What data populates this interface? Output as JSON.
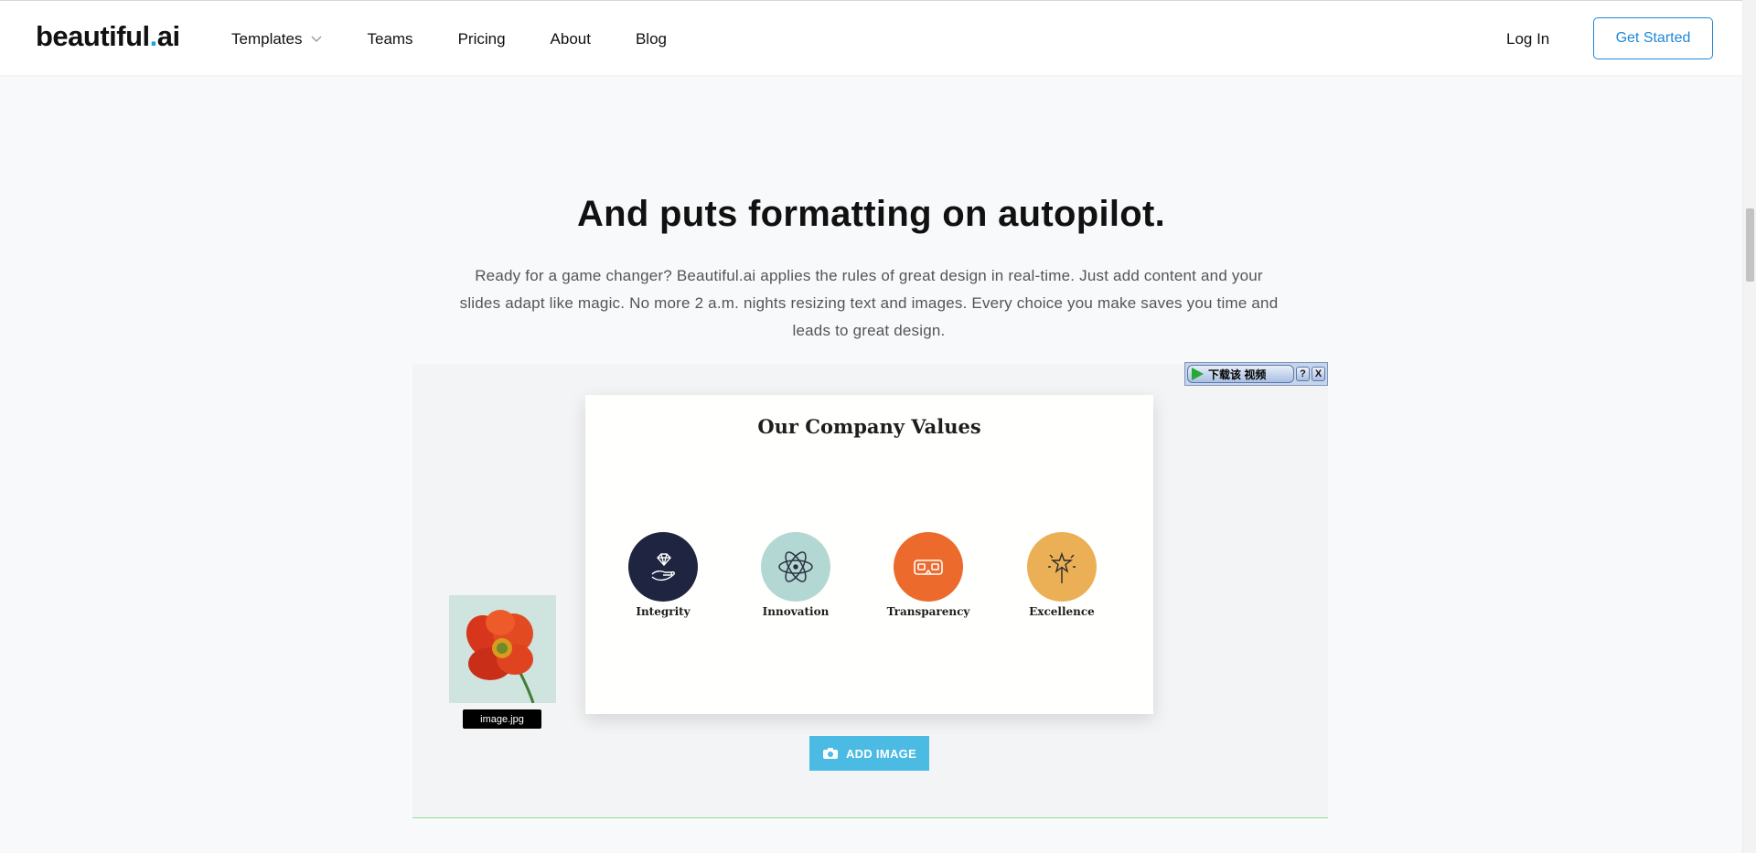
{
  "brand": {
    "logo_main": "beautiful",
    "logo_dot": ".",
    "logo_suffix": "ai"
  },
  "nav": {
    "items": [
      {
        "label": "Templates",
        "has_dropdown": true
      },
      {
        "label": "Teams"
      },
      {
        "label": "Pricing"
      },
      {
        "label": "About"
      },
      {
        "label": "Blog"
      }
    ],
    "login_label": "Log In",
    "cta_label": "Get Started"
  },
  "section": {
    "heading": "And puts formatting on autopilot.",
    "body": "Ready for a game changer? Beautiful.ai applies the rules of great design in real-time. Just add content and your slides adapt like magic. No more 2 a.m. nights resizing text and images. Every choice you make saves you time and leads to great design."
  },
  "slide": {
    "title": "Our Company Values",
    "values": [
      {
        "label": "Integrity",
        "icon": "diamond-hand-icon",
        "color": "#1f2440"
      },
      {
        "label": "Innovation",
        "icon": "atom-icon",
        "color": "#b3d8d4"
      },
      {
        "label": "Transparency",
        "icon": "vr-goggles-icon",
        "color": "#ec6a2c"
      },
      {
        "label": "Excellence",
        "icon": "star-wand-icon",
        "color": "#ebb055"
      }
    ]
  },
  "dragged_image": {
    "filename": "image.jpg"
  },
  "add_image_label": "ADD IMAGE",
  "download_widget": {
    "label": "下载该 视频",
    "help": "?",
    "close": "X"
  },
  "colors": {
    "accent": "#1e88d8",
    "add_image_bg": "#4cbbe3",
    "background": "#f8f9fb"
  }
}
